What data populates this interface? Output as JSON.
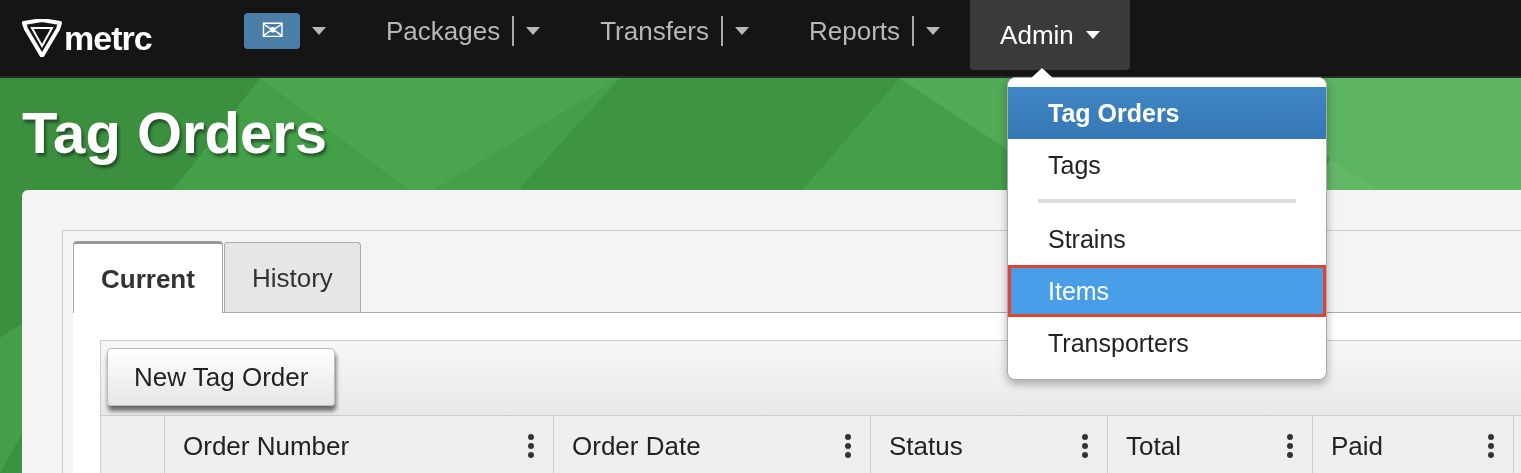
{
  "navbar": {
    "brand": "metrc",
    "items": [
      {
        "kind": "mail",
        "label": "✉",
        "has_menu": true,
        "split": false,
        "selected": false
      },
      {
        "kind": "text",
        "label": "Packages",
        "has_menu": true,
        "split": true,
        "selected": false
      },
      {
        "kind": "text",
        "label": "Transfers",
        "has_menu": true,
        "split": true,
        "selected": false
      },
      {
        "kind": "text",
        "label": "Reports",
        "has_menu": true,
        "split": true,
        "selected": false
      },
      {
        "kind": "text",
        "label": "Admin",
        "has_menu": true,
        "split": false,
        "selected": true
      }
    ]
  },
  "admin_menu": {
    "items": [
      {
        "kind": "item",
        "label": "Tag Orders",
        "active": true,
        "highlighted": false
      },
      {
        "kind": "item",
        "label": "Tags",
        "active": false,
        "highlighted": false
      },
      {
        "kind": "divider"
      },
      {
        "kind": "item",
        "label": "Strains",
        "active": false,
        "highlighted": false
      },
      {
        "kind": "item",
        "label": "Items",
        "active": false,
        "highlighted": true
      },
      {
        "kind": "item",
        "label": "Transporters",
        "active": false,
        "highlighted": false
      }
    ]
  },
  "page": {
    "title": "Tag Orders",
    "tabs": [
      {
        "label": "Current",
        "selected": true
      },
      {
        "label": "History",
        "selected": false
      }
    ],
    "toolbar": {
      "buttons": [
        "New Tag Order"
      ]
    },
    "table": {
      "columns": [
        "Order Number",
        "Order Date",
        "Status",
        "Total",
        "Paid"
      ]
    }
  }
}
